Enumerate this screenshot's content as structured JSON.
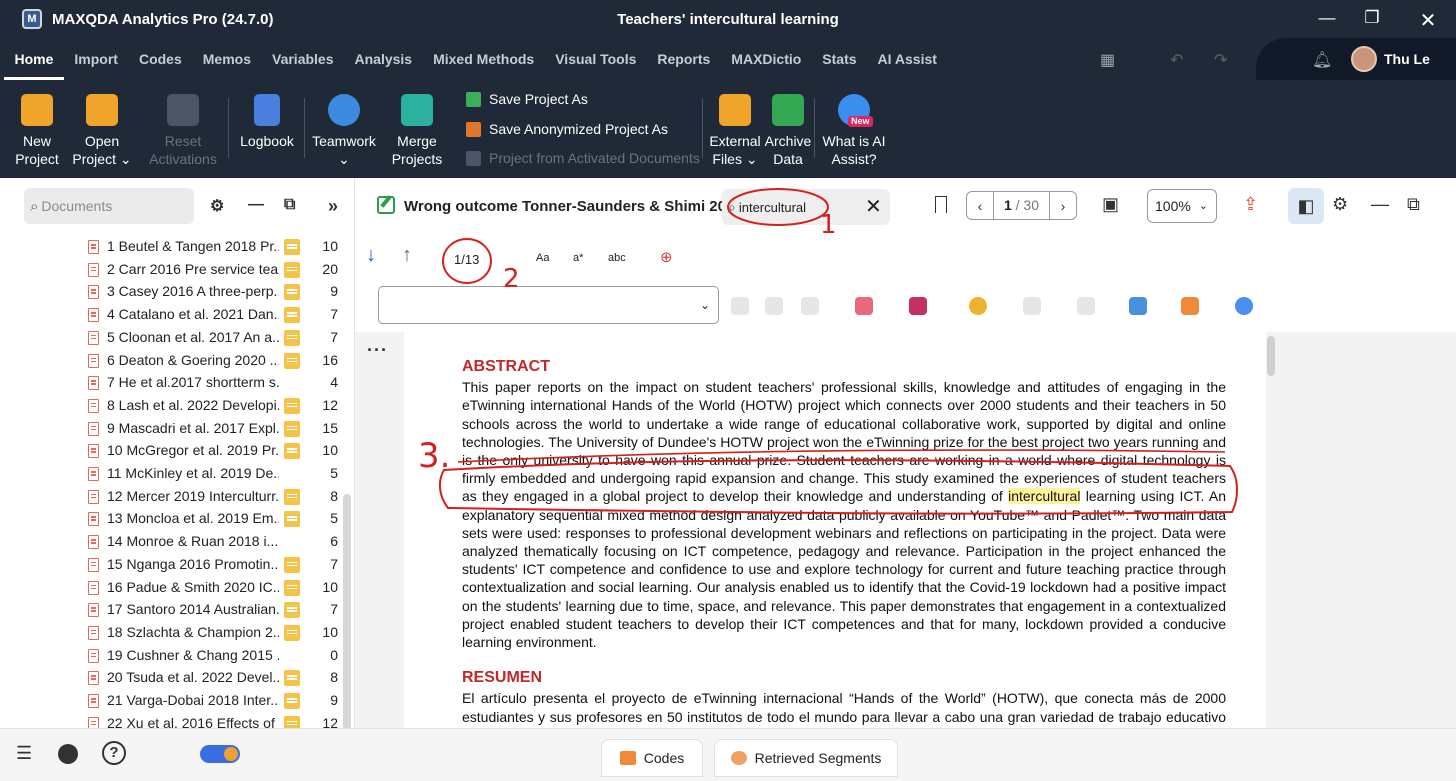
{
  "window": {
    "app_title": "MAXQDA Analytics Pro (24.7.0)",
    "project_title": "Teachers' intercultural learning"
  },
  "menu": {
    "tabs": [
      "Home",
      "Import",
      "Codes",
      "Memos",
      "Variables",
      "Analysis",
      "Mixed Methods",
      "Visual Tools",
      "Reports",
      "MAXDictio",
      "Stats",
      "AI Assist"
    ],
    "user": "Thu Le"
  },
  "ribbon": {
    "new_project": [
      "New",
      "Project"
    ],
    "open_project": [
      "Open",
      "Project ⌄"
    ],
    "reset_activations": [
      "Reset",
      "Activations"
    ],
    "logbook": "Logbook",
    "teamwork": [
      "Teamwork",
      "⌄"
    ],
    "merge_projects": [
      "Merge",
      "Projects"
    ],
    "save_project_as": "Save Project As",
    "save_anonymized": "Save Anonymized Project As",
    "project_from_activated": "Project from Activated Documents",
    "external_files": [
      "External",
      "Files ⌄"
    ],
    "archive_data": [
      "Archive",
      "Data"
    ],
    "ai_assist": [
      "What is AI",
      "Assist?"
    ],
    "new_badge": "New"
  },
  "documents": {
    "search_placeholder": "Documents",
    "items": [
      {
        "name": "1 Beutel & Tangen 2018 Pr...",
        "count": "10",
        "memo": true
      },
      {
        "name": "2 Carr 2016 Pre service tea...",
        "count": "20",
        "memo": true
      },
      {
        "name": "3 Casey 2016 A three-perp...",
        "count": "9",
        "memo": true
      },
      {
        "name": "4 Catalano et al. 2021 Dan...",
        "count": "7",
        "memo": true
      },
      {
        "name": "5 Cloonan et al. 2017 An a...",
        "count": "7",
        "memo": true
      },
      {
        "name": "6 Deaton & Goering 2020 ...",
        "count": "16",
        "memo": true
      },
      {
        "name": "7 He et al.2017 shortterm s...",
        "count": "4",
        "memo": false
      },
      {
        "name": "8 Lash et al. 2022 Developi...",
        "count": "12",
        "memo": true
      },
      {
        "name": "9 Mascadri et al. 2017 Expl...",
        "count": "15",
        "memo": true
      },
      {
        "name": "10 McGregor et al. 2019 Pr...",
        "count": "10",
        "memo": true
      },
      {
        "name": "11 McKinley et al. 2019 De...",
        "count": "5",
        "memo": false
      },
      {
        "name": "12 Mercer 2019 Interculturr...",
        "count": "8",
        "memo": true
      },
      {
        "name": "13 Moncloa et al. 2019 Em...",
        "count": "5",
        "memo": true
      },
      {
        "name": "14 Monroe & Ruan 2018 i...",
        "count": "6",
        "memo": false
      },
      {
        "name": "15 Nganga 2016 Promotin...",
        "count": "7",
        "memo": true
      },
      {
        "name": "16 Padue & Smith 2020 IC...",
        "count": "10",
        "memo": true
      },
      {
        "name": "17 Santoro 2014 Australian...",
        "count": "7",
        "memo": true
      },
      {
        "name": "18 Szlachta & Champion 2...",
        "count": "10",
        "memo": true
      },
      {
        "name": "19 Cushner & Chang 2015 ...",
        "count": "0",
        "memo": false
      },
      {
        "name": "20 Tsuda et al. 2022 Devel...",
        "count": "8",
        "memo": true
      },
      {
        "name": "21 Varga-Dobai 2018 Inter...",
        "count": "9",
        "memo": true
      },
      {
        "name": "22 Xu et al. 2016 Effects of ...",
        "count": "12",
        "memo": true
      }
    ]
  },
  "viewer": {
    "doc_title": "Wrong outcome Tonner-Saunders & Shimi 20",
    "search_value": "intercultural",
    "page_current": "1",
    "page_total": "/ 30",
    "zoom": "100%",
    "hit_count": "1/13",
    "opt_case": "Aa",
    "opt_regex": "a*",
    "opt_word": "abc"
  },
  "page": {
    "abstract_head": "ABSTRACT",
    "abstract_before": "This paper reports on the impact on student teachers' professional skills, knowledge and attitudes of engaging in the eTwinning international Hands of the World (HOTW) project which connects over 2000 students and their teachers in 50 schools across the world to undertake a wide range of educational collaborative work, supported by digital and online technologies. The University of Dundee's HOTW project won the eTwinning prize for the best project two years running and is the only university to have won this annual prize. Student teachers are working in a world where digital technology is firmly embedded and undergoing rapid expansion and change. This study examined the experiences of student teachers as they engaged in a global project to develop their knowledge and understanding of",
    "abstract_hit": "intercultural",
    "abstract_after": "learning using ICT. An explanatory sequential mixed method design analyzed data publicly available on YouTube™ and Padlet™. Two main data sets were used: responses to professional development webinars and reflections on participating in the project. Data were analyzed thematically focusing on ICT competence, pedagogy and relevance. Participation in the project enhanced the students' ICT competence and confidence to use and explore technology for current and future teaching practice through contextualization and social learning. Our analysis enabled us to identify that the Covid-19 lockdown had a positive impact on the students' learning due to time, space, and relevance. This paper demonstrates that engagement in a contextualized project enabled student teachers to develop their ICT competences and that for many, lockdown provided a conducive learning environment.",
    "resumen_head": "RESUMEN",
    "resumen_text": "El artículo presenta el proyecto de eTwinning internacional “Hands of the World” (HOTW), que conecta más de 2000 estudiantes y sus profesores en 50 institutos de todo el mundo para llevar a cabo una gran variedad de trabajo educativo colaborativo apoyado por tecnología digital y en línea, y explora el impacto que ha tenido la participación en el proyecto para"
  },
  "annotations": {
    "n1": "1",
    "n2": "2",
    "n3": "3."
  },
  "bottom": {
    "codes_tab": "Codes",
    "retrieved_tab": "Retrieved Segments"
  }
}
